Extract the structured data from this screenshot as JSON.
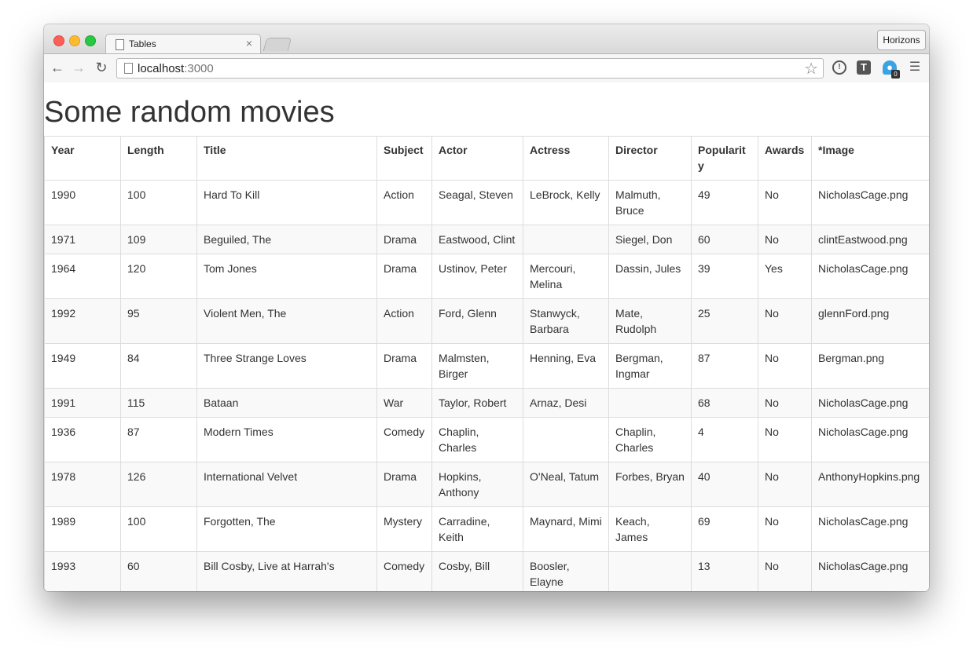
{
  "browser": {
    "tab_title": "Tables",
    "tab_close": "×",
    "profile_label": "Horizons",
    "url_host": "localhost",
    "url_port": ":3000",
    "extension_badge": "0"
  },
  "page": {
    "title": "Some random movies"
  },
  "table": {
    "headers": [
      "Year",
      "Length",
      "Title",
      "Subject",
      "Actor",
      "Actress",
      "Director",
      "Popularity",
      "Awards",
      "*Image"
    ],
    "rows": [
      [
        "1990",
        "100",
        "Hard To Kill",
        "Action",
        "Seagal, Steven",
        "LeBrock, Kelly",
        "Malmuth, Bruce",
        "49",
        "No",
        "NicholasCage.png"
      ],
      [
        "1971",
        "109",
        "Beguiled, The",
        "Drama",
        "Eastwood, Clint",
        "",
        "Siegel, Don",
        "60",
        "No",
        "clintEastwood.png"
      ],
      [
        "1964",
        "120",
        "Tom Jones",
        "Drama",
        "Ustinov, Peter",
        "Mercouri, Melina",
        "Dassin, Jules",
        "39",
        "Yes",
        "NicholasCage.png"
      ],
      [
        "1992",
        "95",
        "Violent Men, The",
        "Action",
        "Ford, Glenn",
        "Stanwyck, Barbara",
        "Mate, Rudolph",
        "25",
        "No",
        "glennFord.png"
      ],
      [
        "1949",
        "84",
        "Three Strange Loves",
        "Drama",
        "Malmsten, Birger",
        "Henning, Eva",
        "Bergman, Ingmar",
        "87",
        "No",
        "Bergman.png"
      ],
      [
        "1991",
        "115",
        "Bataan",
        "War",
        "Taylor, Robert",
        "Arnaz, Desi",
        "",
        "68",
        "No",
        "NicholasCage.png"
      ],
      [
        "1936",
        "87",
        "Modern Times",
        "Comedy",
        "Chaplin, Charles",
        "",
        "Chaplin, Charles",
        "4",
        "No",
        "NicholasCage.png"
      ],
      [
        "1978",
        "126",
        "International Velvet",
        "Drama",
        "Hopkins, Anthony",
        "O'Neal, Tatum",
        "Forbes, Bryan",
        "40",
        "No",
        "AnthonyHopkins.png"
      ],
      [
        "1989",
        "100",
        "Forgotten, The",
        "Mystery",
        "Carradine, Keith",
        "Maynard, Mimi",
        "Keach, James",
        "69",
        "No",
        "NicholasCage.png"
      ],
      [
        "1993",
        "60",
        "Bill Cosby, Live at Harrah's",
        "Comedy",
        "Cosby, Bill",
        "Boosler, Elayne",
        "",
        "13",
        "No",
        "NicholasCage.png"
      ],
      [
        "",
        "",
        "",
        "",
        "",
        "",
        "",
        "",
        "",
        ""
      ]
    ]
  }
}
